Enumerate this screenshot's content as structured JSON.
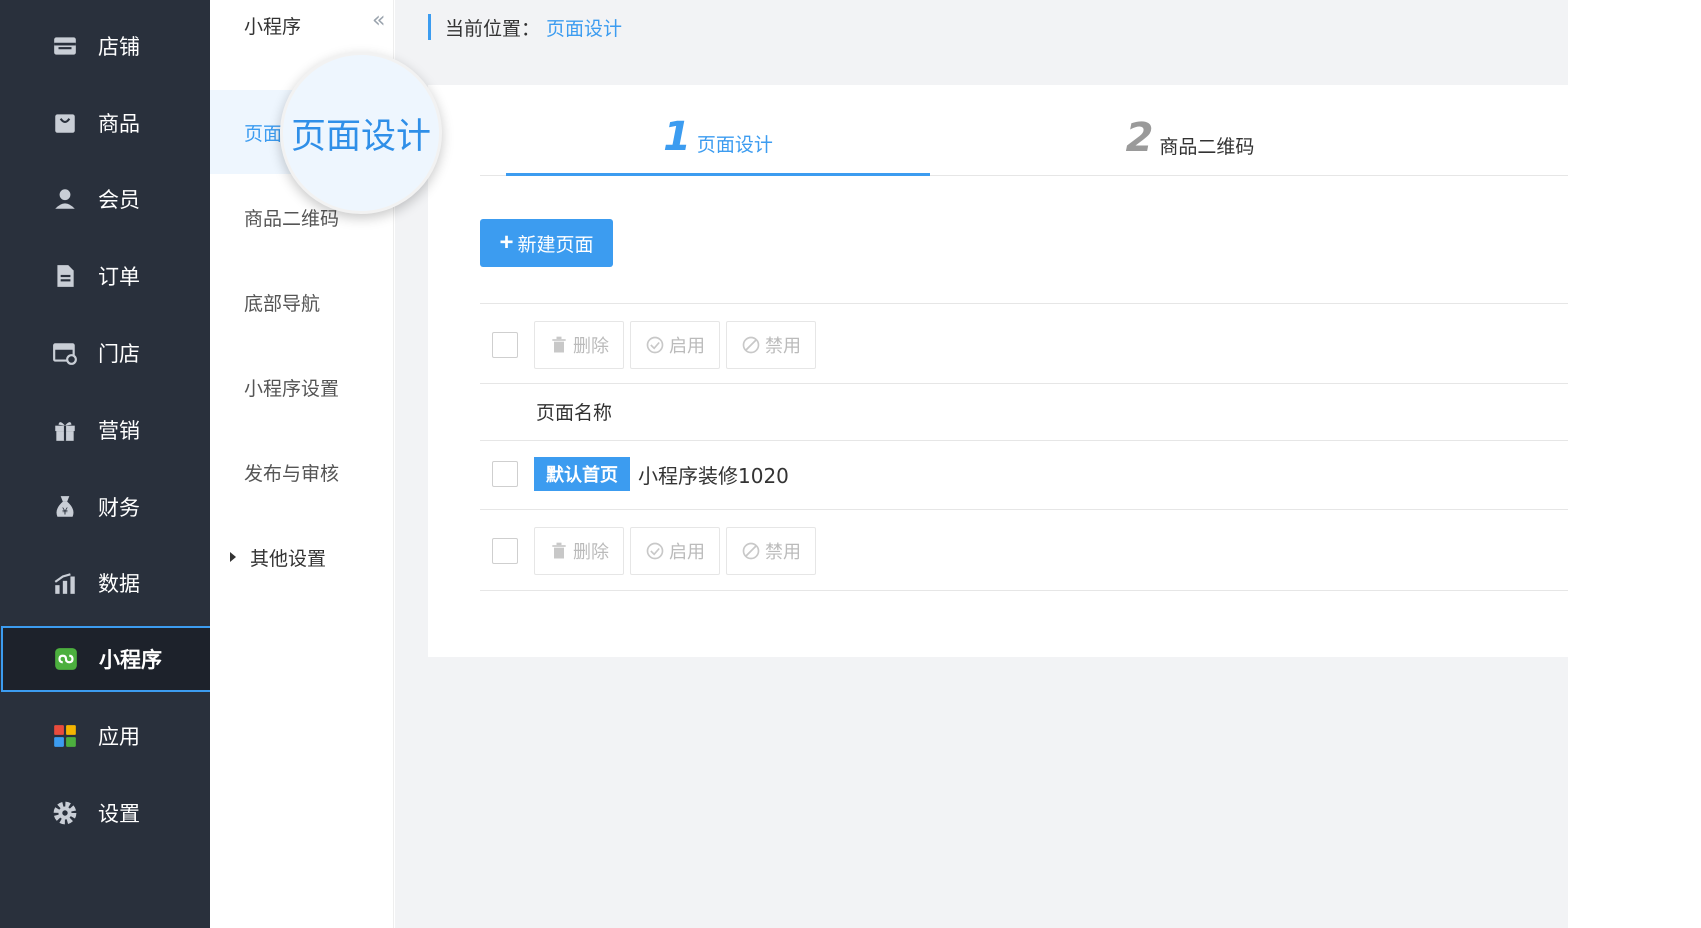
{
  "colors": {
    "sidebar_bg": "#29303c",
    "accent": "#3c9cf0",
    "content_bg": "#f2f3f5"
  },
  "sidebar": {
    "items": [
      {
        "label": "店铺",
        "icon": "store-icon"
      },
      {
        "label": "商品",
        "icon": "bag-icon"
      },
      {
        "label": "会员",
        "icon": "user-icon"
      },
      {
        "label": "订单",
        "icon": "document-icon"
      },
      {
        "label": "门店",
        "icon": "shop-icon"
      },
      {
        "label": "营销",
        "icon": "gift-icon"
      },
      {
        "label": "财务",
        "icon": "money-bag-icon"
      },
      {
        "label": "数据",
        "icon": "bar-chart-icon"
      },
      {
        "label": "小程序",
        "icon": "mini-program-icon",
        "active": true
      },
      {
        "label": "应用",
        "icon": "apps-grid-icon"
      },
      {
        "label": "设置",
        "icon": "gear-icon"
      }
    ]
  },
  "subnav": {
    "title": "小程序",
    "collapse_icon": "«",
    "items": [
      {
        "label": "页面",
        "active": true
      },
      {
        "label": "商品二维码"
      },
      {
        "label": "底部导航"
      },
      {
        "label": "小程序设置"
      },
      {
        "label": "发布与审核"
      },
      {
        "label": "其他设置",
        "group": true
      }
    ]
  },
  "magnifier": {
    "text": "页面设计"
  },
  "breadcrumb": {
    "prefix": "当前位置：",
    "current": "页面设计"
  },
  "steps": [
    {
      "num": "1",
      "label": "页面设计",
      "active": true
    },
    {
      "num": "2",
      "label": "商品二维码",
      "active": false
    }
  ],
  "new_page_button": {
    "plus": "+",
    "label": "新建页面"
  },
  "toolbar": {
    "delete": "删除",
    "enable": "启用",
    "disable": "禁用"
  },
  "table": {
    "column_header": "页面名称",
    "rows": [
      {
        "badge": "默认首页",
        "name": "小程序装修1020"
      }
    ]
  }
}
